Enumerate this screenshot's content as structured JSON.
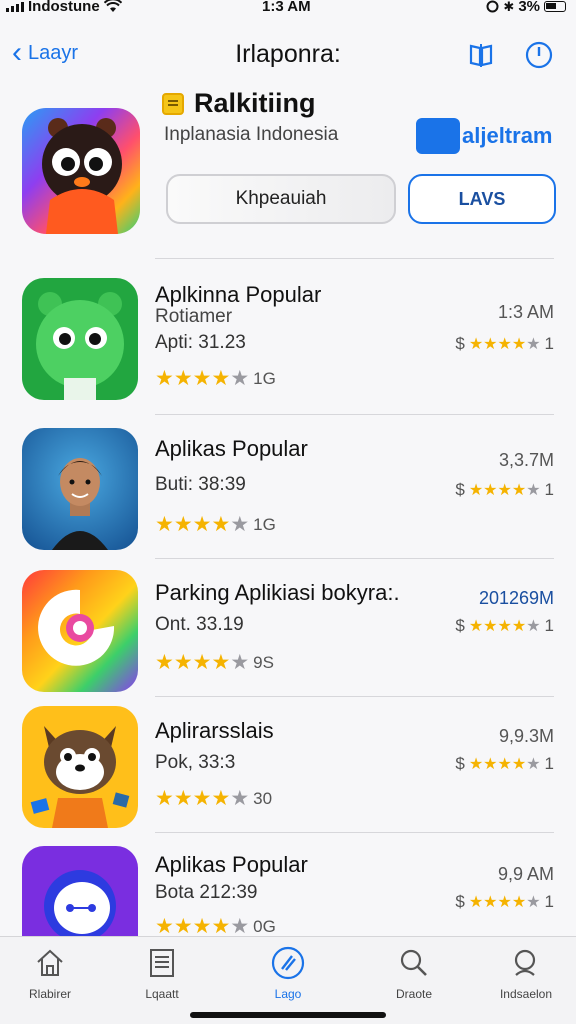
{
  "status_bar": {
    "carrier": "Indostune",
    "time": "1:3 AM",
    "right_text": "3%"
  },
  "nav": {
    "back_label": "Laayr",
    "title": "Irlaponra:"
  },
  "hero": {
    "title": "Ralkitiing",
    "subtitle": "Inplanasia Indonesia",
    "brand_text": "aljeltram",
    "secondary_button": "Khpeauiah",
    "primary_button": "LAVS"
  },
  "apps": [
    {
      "name": "Aplkinna Popular",
      "developer": "Rotiamer",
      "version": "Apti: 31.23",
      "rating_count": "1G",
      "right_top": "1:3 AM",
      "price_label": "$",
      "price_count": "1",
      "stars_filled": 4
    },
    {
      "name": "Aplikas Popular",
      "developer": "",
      "version": "Buti: 38:39",
      "rating_count": "1G",
      "right_top": "3,3.7M",
      "price_label": "$",
      "price_count": "1",
      "stars_filled": 4
    },
    {
      "name": "Parking Aplikiasi bokyra:.",
      "developer": "",
      "version": "Ont. 33.19",
      "rating_count": "9S",
      "right_top": "201269M",
      "price_label": "$",
      "price_count": "1",
      "stars_filled": 4
    },
    {
      "name": "Aplirarsslais",
      "developer": "",
      "version": "Pok, 33:3",
      "rating_count": "30",
      "right_top": "9,9.3M",
      "price_label": "$",
      "price_count": "1",
      "stars_filled": 4
    },
    {
      "name": "Aplikas Popular",
      "developer": "",
      "version": "Bota 212:39",
      "rating_count": "0G",
      "right_top": "9,9 AM",
      "price_label": "$",
      "price_count": "1",
      "stars_filled": 4
    }
  ],
  "tabs": [
    {
      "label": "Rlabirer",
      "icon": "home-icon"
    },
    {
      "label": "Lqaatt",
      "icon": "document-icon"
    },
    {
      "label": "Lago",
      "icon": "compass-icon"
    },
    {
      "label": "Draote",
      "icon": "search-icon"
    },
    {
      "label": "Indsaelon",
      "icon": "search-icon"
    }
  ],
  "colors": {
    "accent": "#1a73e8",
    "star": "#f5b301"
  }
}
